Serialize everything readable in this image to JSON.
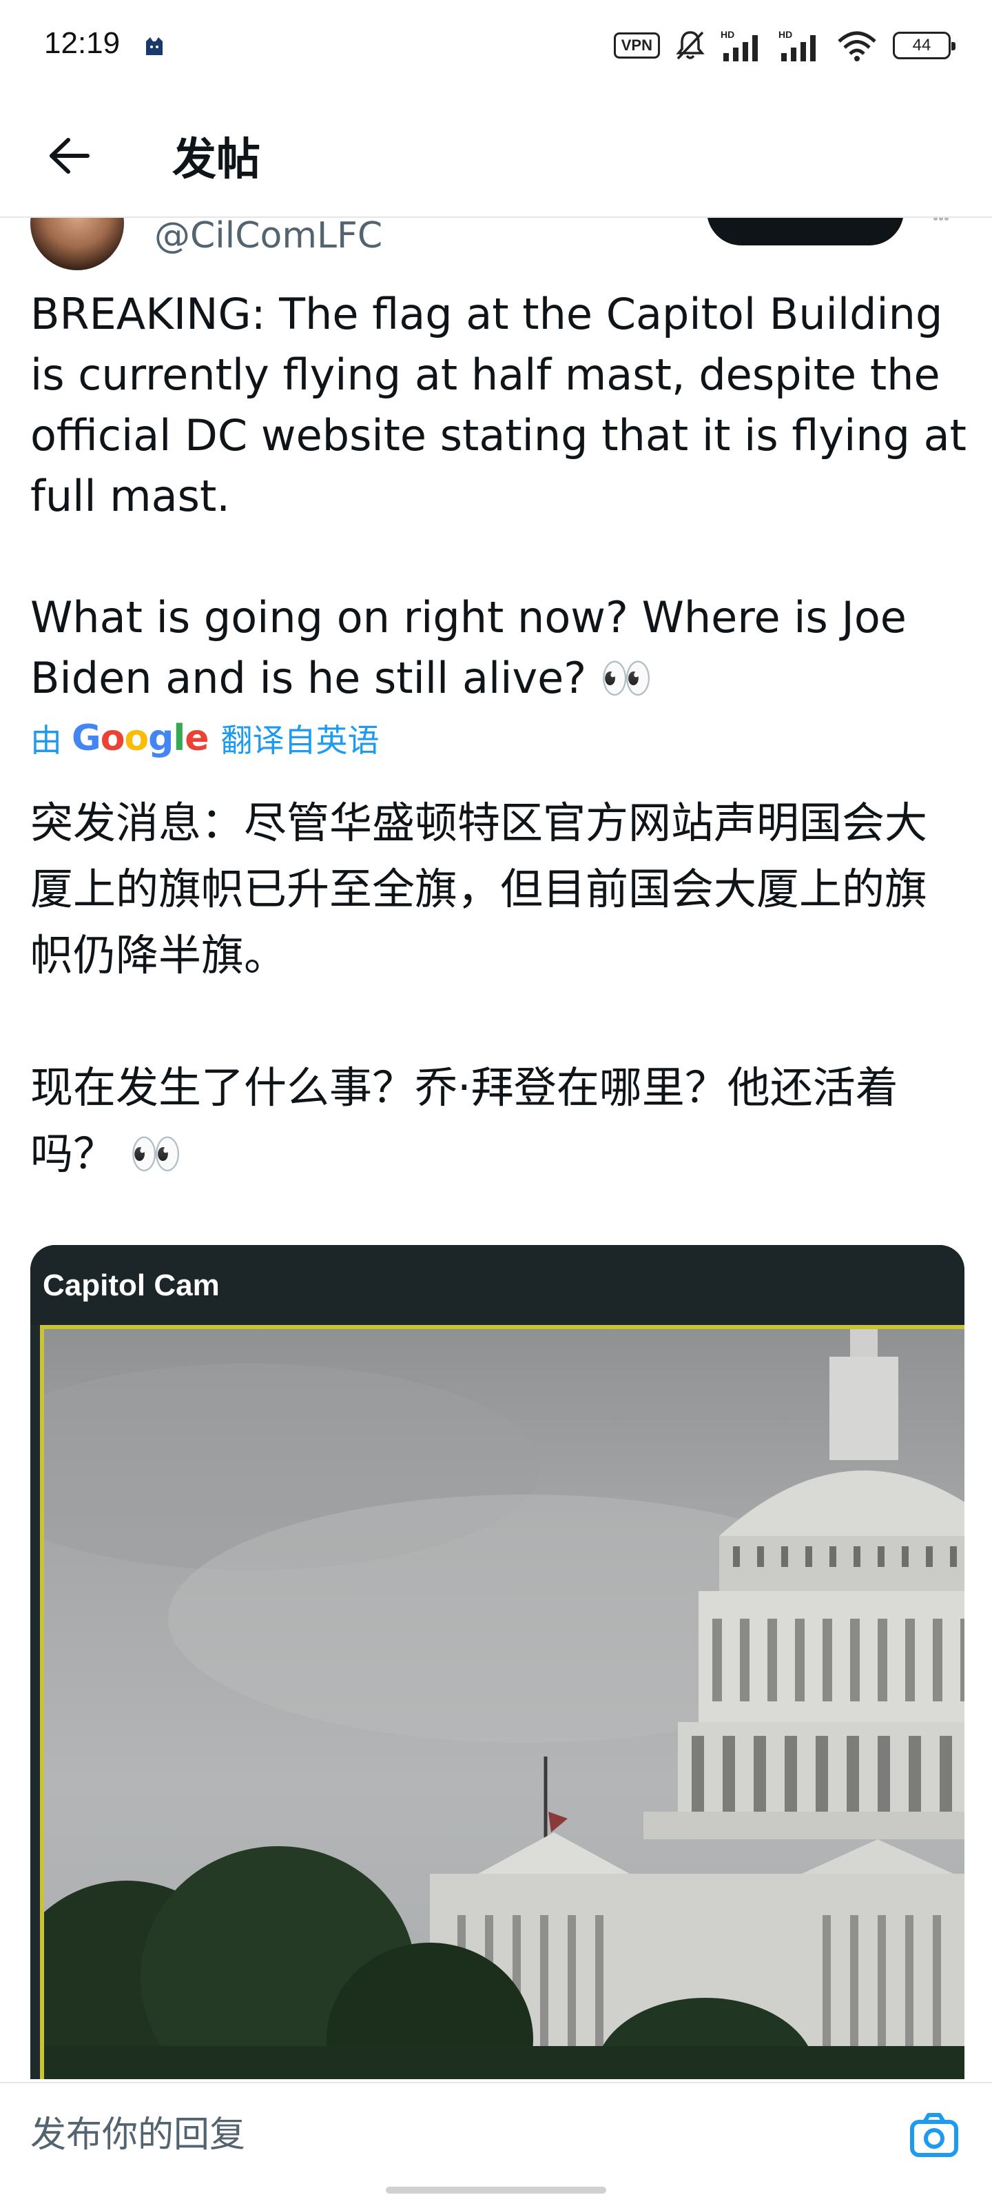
{
  "status_bar": {
    "time": "12:19",
    "vpn": "VPN",
    "battery": "44",
    "icons": [
      "app-icon",
      "vpn-icon",
      "mute-bell-icon",
      "signal-hd-icon",
      "signal-hd-icon",
      "wifi-icon",
      "battery-icon"
    ]
  },
  "header": {
    "title": "发帖",
    "back_icon": "arrow-left-icon"
  },
  "tweet": {
    "handle": "@CilComLFC",
    "text": "BREAKING: The flag at the Capitol Building is currently flying at half mast, despite the official DC website stating that it is flying at full mast.\n\nWhat is going on right now? Where is Joe Biden and is he still alive? 👀",
    "translation_by": "由",
    "translation_brand": "Google",
    "translation_label": "翻译自英语",
    "translated_text": "突发消息：尽管华盛顿特区官方网站声明国会大厦上的旗帜已升至全旗，但目前国会大厦上的旗帜仍降半旗。\n\n现在发生了什么事？乔·拜登在哪里？他还活着吗？ 👀"
  },
  "media": {
    "title": "Capitol Cam"
  },
  "reply": {
    "placeholder": "发布你的回复",
    "camera_icon": "camera-icon"
  },
  "colors": {
    "accent": "#1d9bf0",
    "text": "#0f1419",
    "secondary": "#536471",
    "frame_border": "#c9c435"
  }
}
